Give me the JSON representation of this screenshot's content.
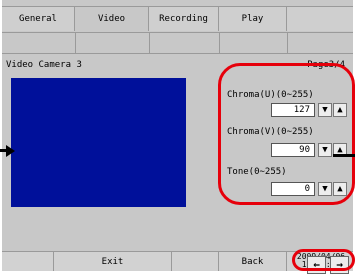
{
  "tabs": [
    {
      "label": "General"
    },
    {
      "label": "Video"
    },
    {
      "label": "Recording"
    },
    {
      "label": "Play"
    }
  ],
  "camera_title": "Video Camera 3",
  "page_indicator": "Page3/4",
  "controls": [
    {
      "label": "Chroma(U)(0∼255)",
      "value": "127"
    },
    {
      "label": "Chroma(V)(0∼255)",
      "value": "90"
    },
    {
      "label": "Tone(0∼255)",
      "value": "0"
    }
  ],
  "buttons": {
    "decrement": "▼",
    "increment": "▲"
  },
  "bottom_bar": {
    "exit_label": "Exit",
    "back_label": "Back"
  },
  "datetime": {
    "date": "2009/04/06",
    "time": "10:41:35"
  },
  "nav": {
    "prev": "←",
    "next": "→"
  },
  "colors": {
    "video_background": "#00109a",
    "callout": "#e6000b",
    "panel": "#c8c8c8"
  }
}
